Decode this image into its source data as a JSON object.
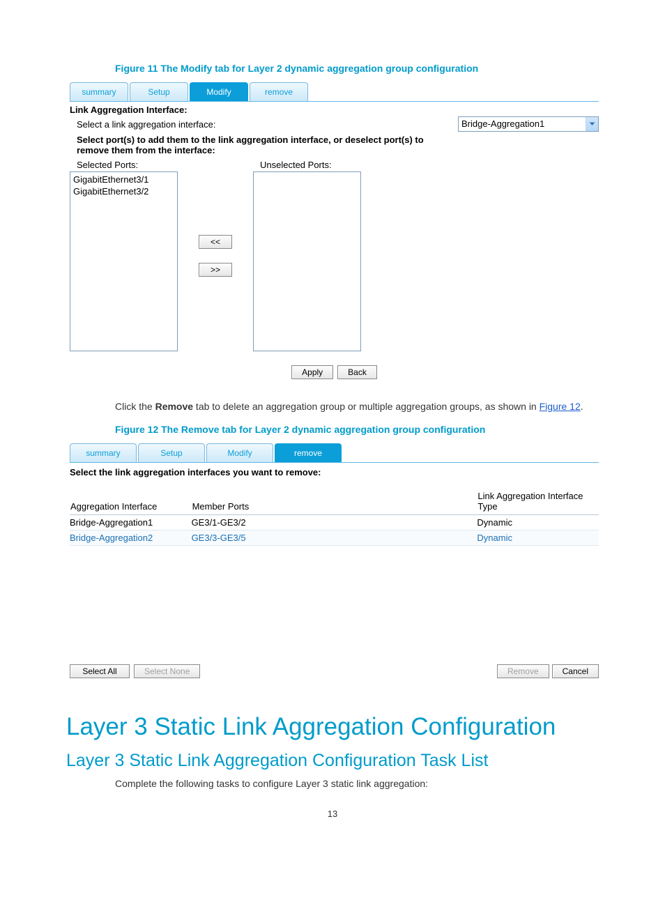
{
  "figure11": {
    "caption_prefix": "Figure 11 The ",
    "caption_bold": "Modify",
    "caption_suffix": " tab for Layer 2 dynamic aggregation group configuration"
  },
  "tabs": {
    "summary": "summary",
    "setup": "Setup",
    "modify": "Modify",
    "remove": "remove"
  },
  "modify_panel": {
    "interface_heading": "Link Aggregation Interface:",
    "select_link_label": "Select a link aggregation interface:",
    "dropdown_value": "Bridge-Aggregation1",
    "port_instruction": "Select port(s) to add them to the link aggregation interface, or deselect port(s) to remove them from the interface:",
    "selected_ports_label": "Selected Ports:",
    "unselected_ports_label": "Unselected Ports:",
    "selected_ports": [
      "GigabitEthernet3/1",
      "GigabitEthernet3/2"
    ],
    "move_left": "<<",
    "move_right": ">>",
    "apply": "Apply",
    "back": "Back"
  },
  "body1": {
    "pre": "Click the ",
    "bold": "Remove",
    "post": " tab to delete an aggregation group or multiple aggregation groups, as shown in ",
    "link": "Figure 12",
    "end": "."
  },
  "figure12": {
    "caption_prefix": "Figure 12 The ",
    "caption_bold": "Remove",
    "caption_suffix": " tab for Layer 2 dynamic aggregation group configuration"
  },
  "remove_panel": {
    "instr": "Select the link aggregation interfaces you want to remove:",
    "columns": {
      "c0": "Aggregation Interface",
      "c1": "Member Ports",
      "c2": "Link Aggregation Interface Type"
    },
    "rows": [
      {
        "if": "Bridge-Aggregation1",
        "ports": "GE3/1-GE3/2",
        "type": "Dynamic"
      },
      {
        "if": "Bridge-Aggregation2",
        "ports": "GE3/3-GE3/5",
        "type": "Dynamic"
      }
    ],
    "select_all": "Select All",
    "select_none": "Select None",
    "remove": "Remove",
    "cancel": "Cancel"
  },
  "headings": {
    "h1": "Layer 3 Static Link Aggregation Configuration",
    "h2": "Layer 3 Static Link Aggregation Configuration Task List",
    "task_intro": "Complete the following tasks to configure Layer 3 static link aggregation:"
  },
  "page_number": "13"
}
